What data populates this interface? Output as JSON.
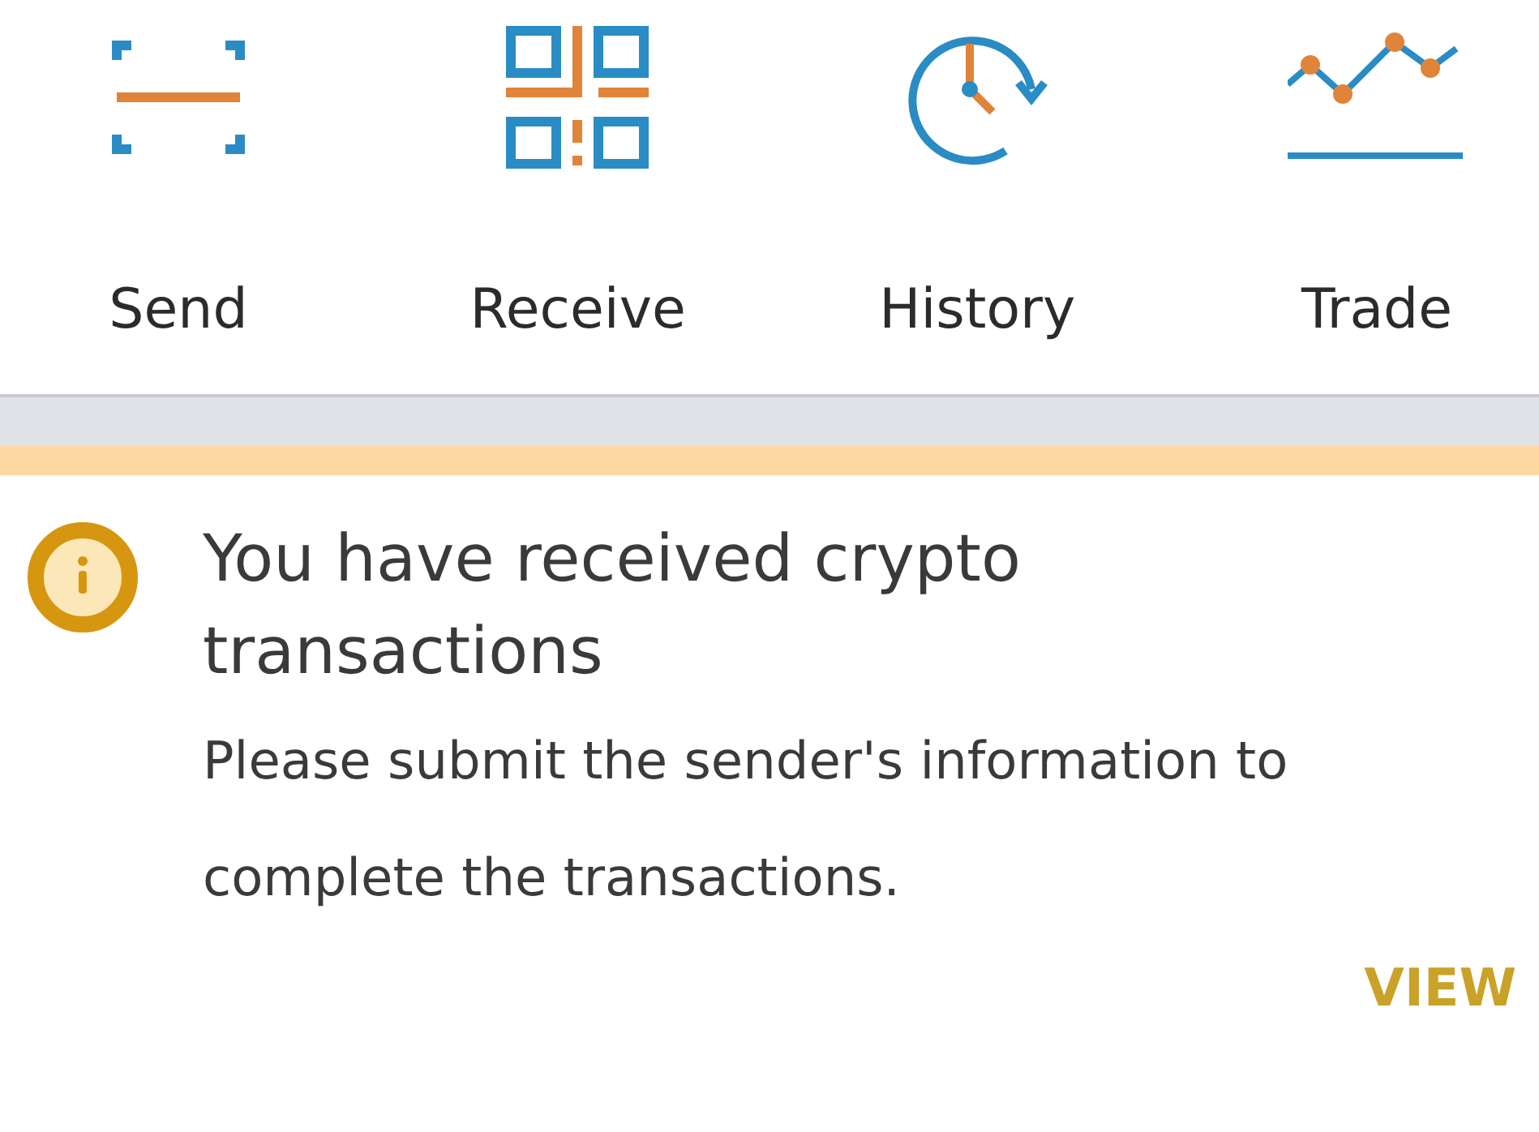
{
  "actions": [
    {
      "kind": "scan",
      "label": "Send"
    },
    {
      "kind": "qr",
      "label": "Receive"
    },
    {
      "kind": "clock",
      "label": "History"
    },
    {
      "kind": "chart",
      "label": "Trade"
    }
  ],
  "notice": {
    "title": "You have received crypto transactions",
    "body": "Please submit the sender's information to complete the transactions.",
    "action": "VIEW"
  }
}
